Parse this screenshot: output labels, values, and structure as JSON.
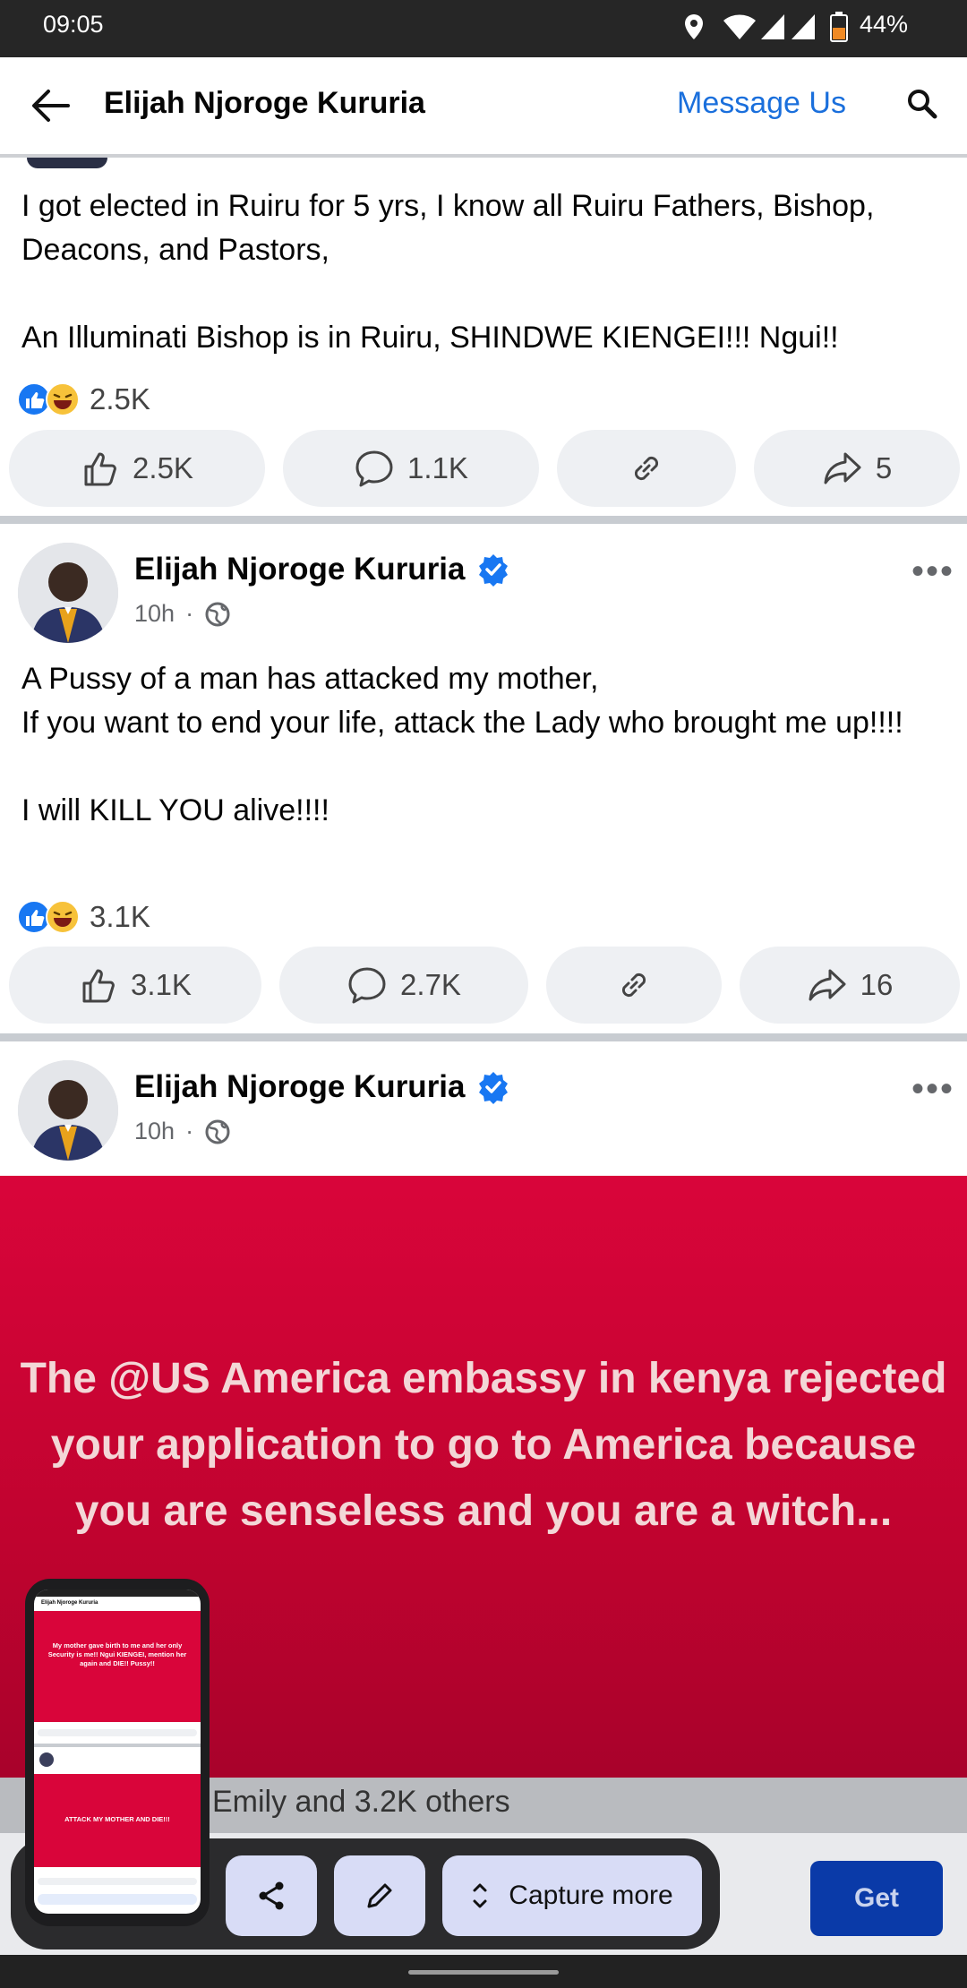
{
  "status_bar": {
    "time": "09:05",
    "battery": "44%"
  },
  "header": {
    "title": "Elijah Njoroge Kururia",
    "message_us": "Message Us"
  },
  "post1": {
    "text": "I got elected in Ruiru for 5 yrs, I know all Ruiru Fathers, Bishop, Deacons, and Pastors,\n\nAn Illuminati Bishop is in Ruiru, SHINDWE KIENGEI!!! Ngui!!",
    "reactions": "2.5K",
    "likes": "2.5K",
    "comments": "1.1K",
    "shares": "5"
  },
  "post2": {
    "author": "Elijah Njoroge Kururia",
    "time": "10h",
    "text": "A Pussy of a man has attacked my mother,\nIf you want to end your life, attack the Lady who brought me up!!!!\n\nI will KILL YOU alive!!!!",
    "reactions": "3.1K",
    "likes": "3.1K",
    "comments": "2.7K",
    "shares": "16"
  },
  "post3": {
    "author": "Elijah Njoroge Kururia",
    "time": "10h",
    "banner_text": "The @US America embassy in kenya rejected your application to go to America because you are senseless and you are a witch...",
    "likes_line": "Emily and 3.2K others"
  },
  "screenshot_toolbar": {
    "capture_more": "Capture more",
    "get": "Get"
  },
  "mini_preview": {
    "header": "Elijah Njoroge Kururia",
    "banner1": "My mother gave birth to me and her only Security is me!! Ngui KIENGEI, mention her again and DIE!! Pussy!!",
    "banner2": "ATTACK MY MOTHER AND DIE!!!"
  },
  "colors": {
    "accent": "#1a6fdc",
    "banner": "#d9053a",
    "verified": "#1877f2"
  }
}
